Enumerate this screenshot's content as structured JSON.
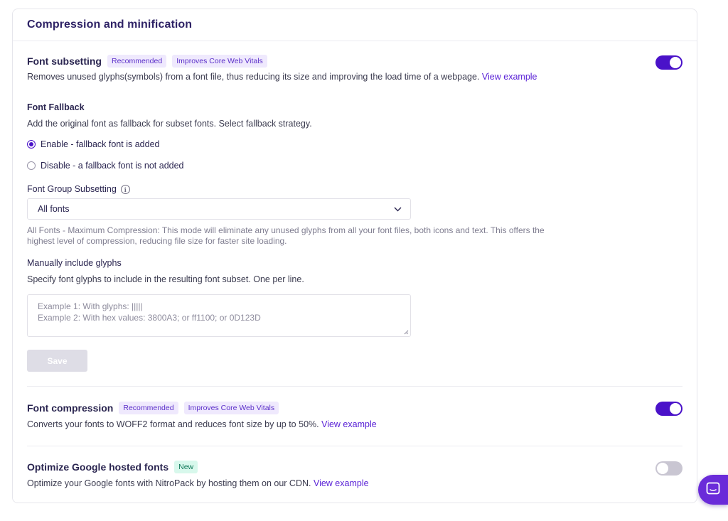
{
  "card": {
    "title": "Compression and minification"
  },
  "font_subsetting": {
    "title": "Font subsetting",
    "badges": [
      "Recommended",
      "Improves Core Web Vitals"
    ],
    "description": "Removes unused glyphs(symbols) from a font file, thus reducing its size and improving the load time of a webpage.",
    "link": "View example",
    "enabled": true
  },
  "font_fallback": {
    "label": "Font Fallback",
    "description": "Add the original font as fallback for subset fonts. Select fallback strategy.",
    "options": [
      {
        "label": "Enable - fallback font is added",
        "checked": true
      },
      {
        "label": "Disable - a fallback font is not added",
        "checked": false
      }
    ]
  },
  "font_group": {
    "label": "Font Group Subsetting",
    "selected": "All fonts",
    "hint": "All Fonts - Maximum Compression: This mode will eliminate any unused glyphs from all your font files, both icons and text. This offers the highest level of compression, reducing file size for faster site loading."
  },
  "manual_glyphs": {
    "label": "Manually include glyphs",
    "description": "Specify font glyphs to include in the resulting font subset. One per line.",
    "placeholder_line1": "Example 1: With glyphs: |||||",
    "placeholder_line2": "Example 2: With hex values: 3800A3; or ff1100; or 0D123D",
    "save_label": "Save"
  },
  "font_compression": {
    "title": "Font compression",
    "badges": [
      "Recommended",
      "Improves Core Web Vitals"
    ],
    "description": "Converts your fonts to WOFF2 format and reduces font size by up to 50%.",
    "link": "View example",
    "enabled": true
  },
  "google_fonts": {
    "title": "Optimize Google hosted fonts",
    "badge": "New",
    "description": "Optimize your Google fonts with NitroPack by hosting them on our CDN.",
    "link": "View example",
    "enabled": false
  },
  "colors": {
    "accent": "#4a12c9",
    "link": "#5a22d6",
    "title": "#2f2366"
  },
  "icons": {
    "info": "info-icon",
    "chevron": "chevron-down-icon",
    "chat": "chat-icon"
  }
}
